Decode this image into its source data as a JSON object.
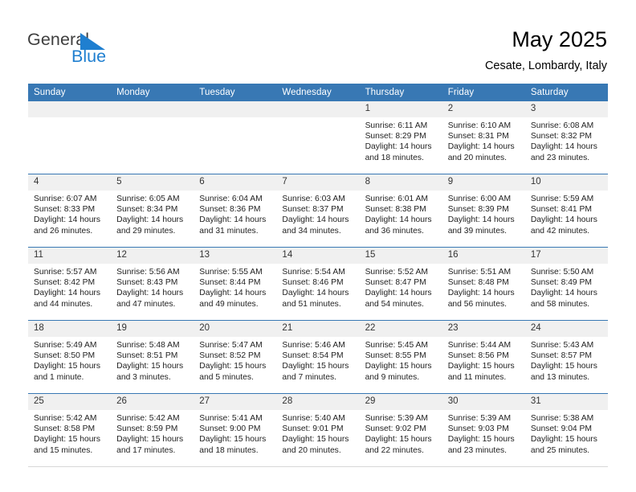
{
  "logo": {
    "word1": "General",
    "word2": "Blue",
    "triangle_color": "#1f7fd0",
    "word1_color": "#3f3f3f",
    "word2_color": "#1f7fd0"
  },
  "header": {
    "title": "May 2025",
    "subtitle": "Cesate, Lombardy, Italy"
  },
  "theme": {
    "header_bg": "#3878b4",
    "header_text": "#ffffff",
    "daynum_bg": "#f0f0f0",
    "row_divider": "#3878b4"
  },
  "calendar": {
    "weekday_headers": [
      "Sunday",
      "Monday",
      "Tuesday",
      "Wednesday",
      "Thursday",
      "Friday",
      "Saturday"
    ],
    "weeks": [
      [
        {
          "day": "",
          "sunrise": "",
          "sunset": "",
          "daylight1": "",
          "daylight2": ""
        },
        {
          "day": "",
          "sunrise": "",
          "sunset": "",
          "daylight1": "",
          "daylight2": ""
        },
        {
          "day": "",
          "sunrise": "",
          "sunset": "",
          "daylight1": "",
          "daylight2": ""
        },
        {
          "day": "",
          "sunrise": "",
          "sunset": "",
          "daylight1": "",
          "daylight2": ""
        },
        {
          "day": "1",
          "sunrise": "Sunrise: 6:11 AM",
          "sunset": "Sunset: 8:29 PM",
          "daylight1": "Daylight: 14 hours",
          "daylight2": "and 18 minutes."
        },
        {
          "day": "2",
          "sunrise": "Sunrise: 6:10 AM",
          "sunset": "Sunset: 8:31 PM",
          "daylight1": "Daylight: 14 hours",
          "daylight2": "and 20 minutes."
        },
        {
          "day": "3",
          "sunrise": "Sunrise: 6:08 AM",
          "sunset": "Sunset: 8:32 PM",
          "daylight1": "Daylight: 14 hours",
          "daylight2": "and 23 minutes."
        }
      ],
      [
        {
          "day": "4",
          "sunrise": "Sunrise: 6:07 AM",
          "sunset": "Sunset: 8:33 PM",
          "daylight1": "Daylight: 14 hours",
          "daylight2": "and 26 minutes."
        },
        {
          "day": "5",
          "sunrise": "Sunrise: 6:05 AM",
          "sunset": "Sunset: 8:34 PM",
          "daylight1": "Daylight: 14 hours",
          "daylight2": "and 29 minutes."
        },
        {
          "day": "6",
          "sunrise": "Sunrise: 6:04 AM",
          "sunset": "Sunset: 8:36 PM",
          "daylight1": "Daylight: 14 hours",
          "daylight2": "and 31 minutes."
        },
        {
          "day": "7",
          "sunrise": "Sunrise: 6:03 AM",
          "sunset": "Sunset: 8:37 PM",
          "daylight1": "Daylight: 14 hours",
          "daylight2": "and 34 minutes."
        },
        {
          "day": "8",
          "sunrise": "Sunrise: 6:01 AM",
          "sunset": "Sunset: 8:38 PM",
          "daylight1": "Daylight: 14 hours",
          "daylight2": "and 36 minutes."
        },
        {
          "day": "9",
          "sunrise": "Sunrise: 6:00 AM",
          "sunset": "Sunset: 8:39 PM",
          "daylight1": "Daylight: 14 hours",
          "daylight2": "and 39 minutes."
        },
        {
          "day": "10",
          "sunrise": "Sunrise: 5:59 AM",
          "sunset": "Sunset: 8:41 PM",
          "daylight1": "Daylight: 14 hours",
          "daylight2": "and 42 minutes."
        }
      ],
      [
        {
          "day": "11",
          "sunrise": "Sunrise: 5:57 AM",
          "sunset": "Sunset: 8:42 PM",
          "daylight1": "Daylight: 14 hours",
          "daylight2": "and 44 minutes."
        },
        {
          "day": "12",
          "sunrise": "Sunrise: 5:56 AM",
          "sunset": "Sunset: 8:43 PM",
          "daylight1": "Daylight: 14 hours",
          "daylight2": "and 47 minutes."
        },
        {
          "day": "13",
          "sunrise": "Sunrise: 5:55 AM",
          "sunset": "Sunset: 8:44 PM",
          "daylight1": "Daylight: 14 hours",
          "daylight2": "and 49 minutes."
        },
        {
          "day": "14",
          "sunrise": "Sunrise: 5:54 AM",
          "sunset": "Sunset: 8:46 PM",
          "daylight1": "Daylight: 14 hours",
          "daylight2": "and 51 minutes."
        },
        {
          "day": "15",
          "sunrise": "Sunrise: 5:52 AM",
          "sunset": "Sunset: 8:47 PM",
          "daylight1": "Daylight: 14 hours",
          "daylight2": "and 54 minutes."
        },
        {
          "day": "16",
          "sunrise": "Sunrise: 5:51 AM",
          "sunset": "Sunset: 8:48 PM",
          "daylight1": "Daylight: 14 hours",
          "daylight2": "and 56 minutes."
        },
        {
          "day": "17",
          "sunrise": "Sunrise: 5:50 AM",
          "sunset": "Sunset: 8:49 PM",
          "daylight1": "Daylight: 14 hours",
          "daylight2": "and 58 minutes."
        }
      ],
      [
        {
          "day": "18",
          "sunrise": "Sunrise: 5:49 AM",
          "sunset": "Sunset: 8:50 PM",
          "daylight1": "Daylight: 15 hours",
          "daylight2": "and 1 minute."
        },
        {
          "day": "19",
          "sunrise": "Sunrise: 5:48 AM",
          "sunset": "Sunset: 8:51 PM",
          "daylight1": "Daylight: 15 hours",
          "daylight2": "and 3 minutes."
        },
        {
          "day": "20",
          "sunrise": "Sunrise: 5:47 AM",
          "sunset": "Sunset: 8:52 PM",
          "daylight1": "Daylight: 15 hours",
          "daylight2": "and 5 minutes."
        },
        {
          "day": "21",
          "sunrise": "Sunrise: 5:46 AM",
          "sunset": "Sunset: 8:54 PM",
          "daylight1": "Daylight: 15 hours",
          "daylight2": "and 7 minutes."
        },
        {
          "day": "22",
          "sunrise": "Sunrise: 5:45 AM",
          "sunset": "Sunset: 8:55 PM",
          "daylight1": "Daylight: 15 hours",
          "daylight2": "and 9 minutes."
        },
        {
          "day": "23",
          "sunrise": "Sunrise: 5:44 AM",
          "sunset": "Sunset: 8:56 PM",
          "daylight1": "Daylight: 15 hours",
          "daylight2": "and 11 minutes."
        },
        {
          "day": "24",
          "sunrise": "Sunrise: 5:43 AM",
          "sunset": "Sunset: 8:57 PM",
          "daylight1": "Daylight: 15 hours",
          "daylight2": "and 13 minutes."
        }
      ],
      [
        {
          "day": "25",
          "sunrise": "Sunrise: 5:42 AM",
          "sunset": "Sunset: 8:58 PM",
          "daylight1": "Daylight: 15 hours",
          "daylight2": "and 15 minutes."
        },
        {
          "day": "26",
          "sunrise": "Sunrise: 5:42 AM",
          "sunset": "Sunset: 8:59 PM",
          "daylight1": "Daylight: 15 hours",
          "daylight2": "and 17 minutes."
        },
        {
          "day": "27",
          "sunrise": "Sunrise: 5:41 AM",
          "sunset": "Sunset: 9:00 PM",
          "daylight1": "Daylight: 15 hours",
          "daylight2": "and 18 minutes."
        },
        {
          "day": "28",
          "sunrise": "Sunrise: 5:40 AM",
          "sunset": "Sunset: 9:01 PM",
          "daylight1": "Daylight: 15 hours",
          "daylight2": "and 20 minutes."
        },
        {
          "day": "29",
          "sunrise": "Sunrise: 5:39 AM",
          "sunset": "Sunset: 9:02 PM",
          "daylight1": "Daylight: 15 hours",
          "daylight2": "and 22 minutes."
        },
        {
          "day": "30",
          "sunrise": "Sunrise: 5:39 AM",
          "sunset": "Sunset: 9:03 PM",
          "daylight1": "Daylight: 15 hours",
          "daylight2": "and 23 minutes."
        },
        {
          "day": "31",
          "sunrise": "Sunrise: 5:38 AM",
          "sunset": "Sunset: 9:04 PM",
          "daylight1": "Daylight: 15 hours",
          "daylight2": "and 25 minutes."
        }
      ]
    ]
  }
}
